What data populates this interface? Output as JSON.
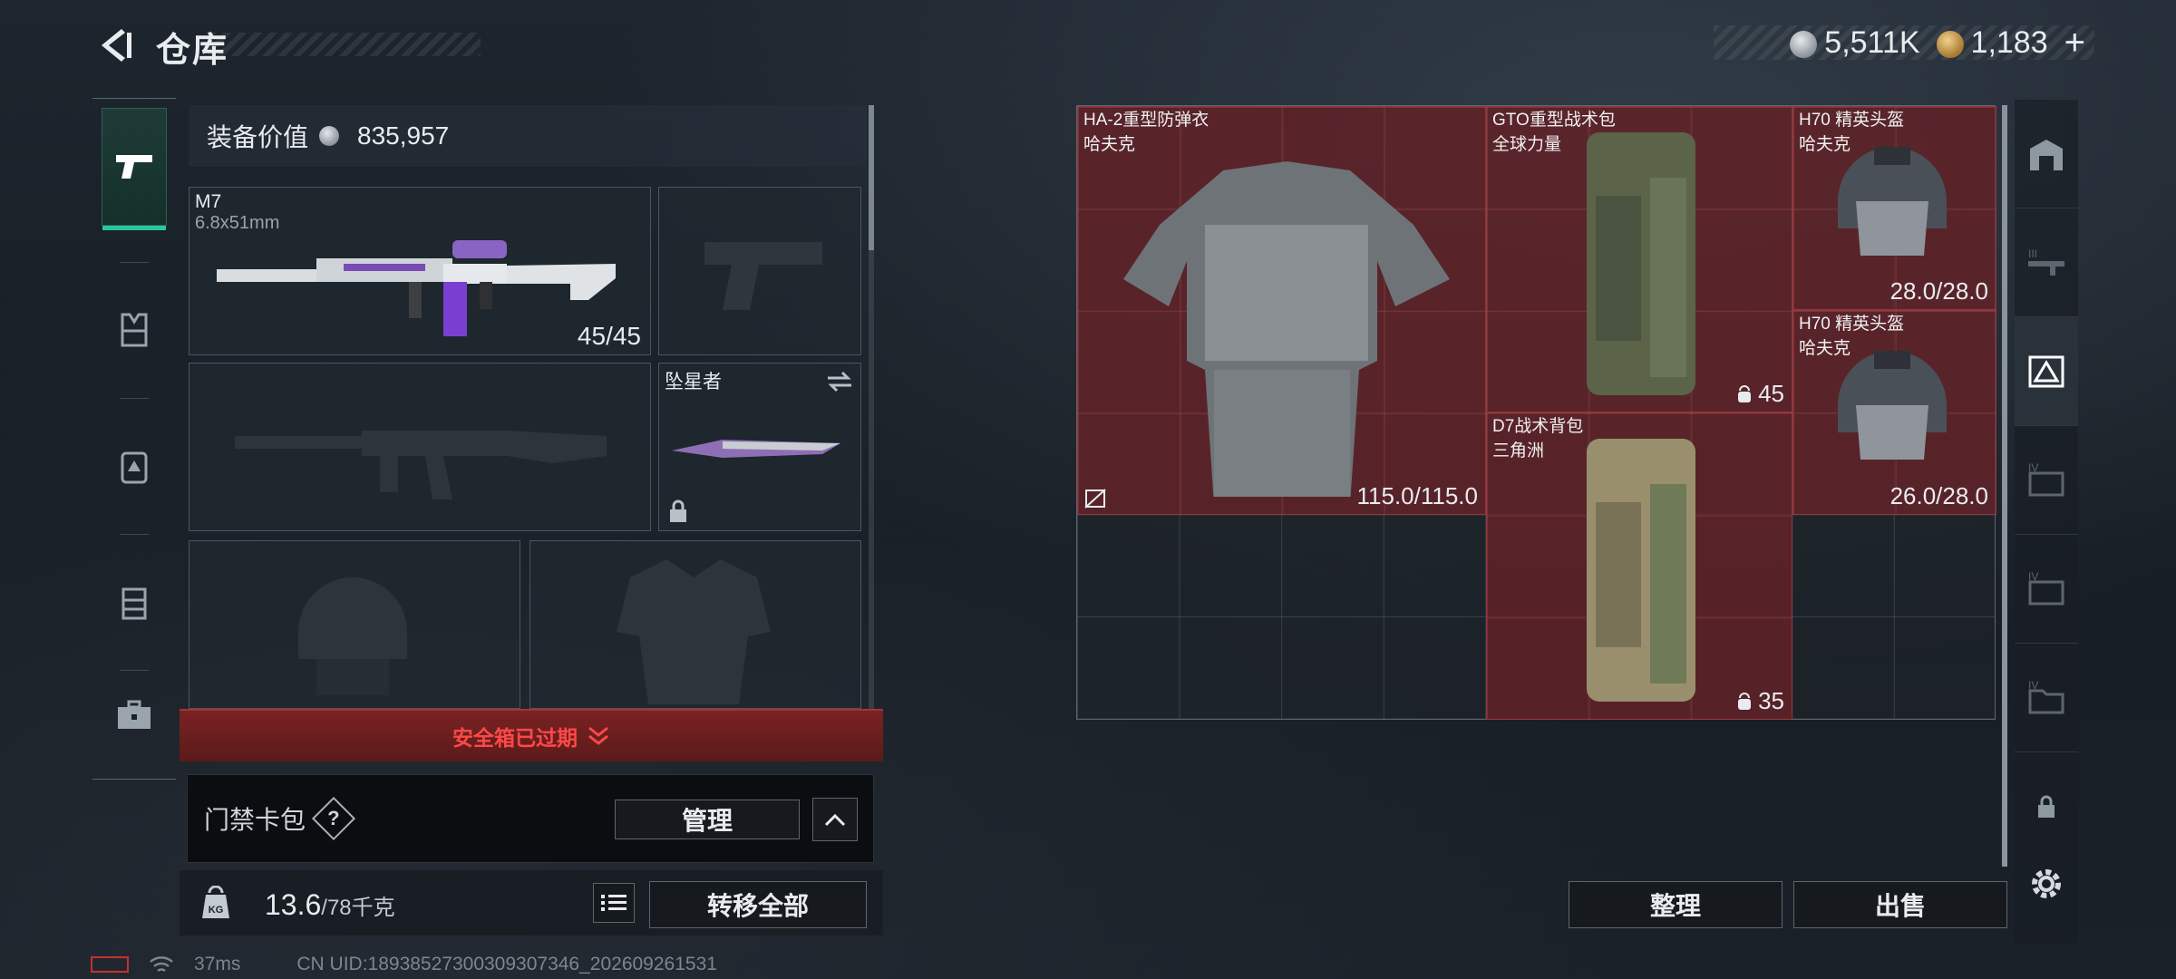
{
  "header": {
    "title": "仓库"
  },
  "currency": {
    "silver": "5,511K",
    "gold": "1,183",
    "add": "+"
  },
  "loadout": {
    "equip_value_label": "装备价值",
    "equip_value": "835,957",
    "weapon1": {
      "name": "M7",
      "caliber": "6.8x51mm",
      "ammo": "45/45"
    },
    "melee": {
      "name": "坠星者"
    },
    "safe_box_expired": "安全箱已过期",
    "keycard_label": "门禁卡包",
    "help": "?",
    "manage_label": "管理",
    "weight_value": "13.6",
    "weight_capacity": "/78千克",
    "transfer_all": "转移全部"
  },
  "storage": {
    "items": [
      {
        "name": "HA-2重型防弹衣",
        "brand": "哈夫克",
        "value": "115.0/115.0"
      },
      {
        "name": "GTO重型战术包",
        "brand": "全球力量",
        "value": "45"
      },
      {
        "name": "H70 精英头盔",
        "brand": "哈夫克",
        "value": "28.0/28.0"
      },
      {
        "name": "H70 精英头盔",
        "brand": "哈夫克",
        "value": "26.0/28.0"
      },
      {
        "name": "D7战术背包",
        "brand": "三角洲",
        "value": "35"
      }
    ],
    "sort_label": "整理",
    "sell_label": "出售"
  },
  "footer": {
    "ping": "37ms",
    "uid": "CN UID:18938527300309307346_202609261531"
  },
  "colors": {
    "accent_green": "#29c79a",
    "expired_red": "#ff4848",
    "item_bg": "#6e2328"
  }
}
